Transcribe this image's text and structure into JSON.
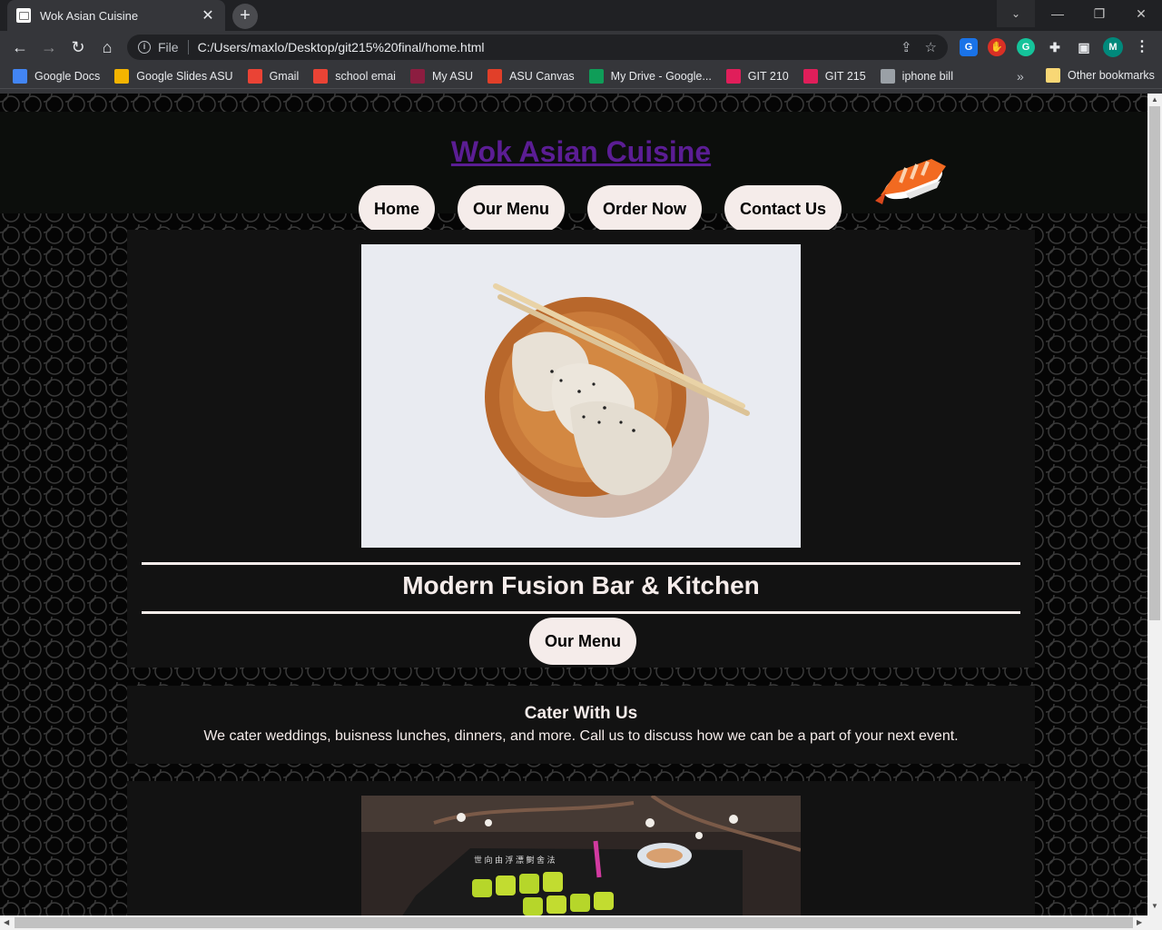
{
  "browser": {
    "tab_title": "Wok Asian Cuisine",
    "tab_close": "✕",
    "new_tab": "+",
    "scheme_label": "File",
    "url": "C:/Users/maxlo/Desktop/git215%20final/home.html",
    "profile_initial": "M",
    "bookmarks": [
      {
        "label": "Google Docs",
        "icon": "google-docs-icon",
        "color": "#4285f4"
      },
      {
        "label": "Google Slides ASU",
        "icon": "google-slides-icon",
        "color": "#f4b400"
      },
      {
        "label": "Gmail",
        "icon": "gmail-icon",
        "color": "#ea4335"
      },
      {
        "label": "school emai",
        "icon": "gmail-icon",
        "color": "#ea4335"
      },
      {
        "label": "My ASU",
        "icon": "asu-icon",
        "color": "#8c1d40"
      },
      {
        "label": "ASU Canvas",
        "icon": "canvas-icon",
        "color": "#e13f29"
      },
      {
        "label": "My Drive - Google...",
        "icon": "google-drive-icon",
        "color": "#0f9d58"
      },
      {
        "label": "GIT 210",
        "icon": "slack-icon",
        "color": "#e01e5a"
      },
      {
        "label": "GIT 215",
        "icon": "slack-icon",
        "color": "#e01e5a"
      },
      {
        "label": "iphone bill",
        "icon": "globe-icon",
        "color": "#9aa0a6"
      }
    ],
    "bookmarks_overflow": "»",
    "other_bookmarks": "Other bookmarks"
  },
  "site": {
    "title": "Wok Asian Cuisine",
    "nav": [
      "Home",
      "Our Menu",
      "Order Now",
      "Contact Us"
    ],
    "tagline": "Modern Fusion Bar & Kitchen",
    "menu_button": "Our Menu",
    "cater_title": "Cater With Us",
    "cater_text": "We cater weddings, buisness lunches, dinners, and more. Call us to discuss how we can be a part of your next event."
  },
  "colors": {
    "title_link": "#5b1d94",
    "pill_bg": "#f5ecea",
    "card_bg": "#121212"
  }
}
